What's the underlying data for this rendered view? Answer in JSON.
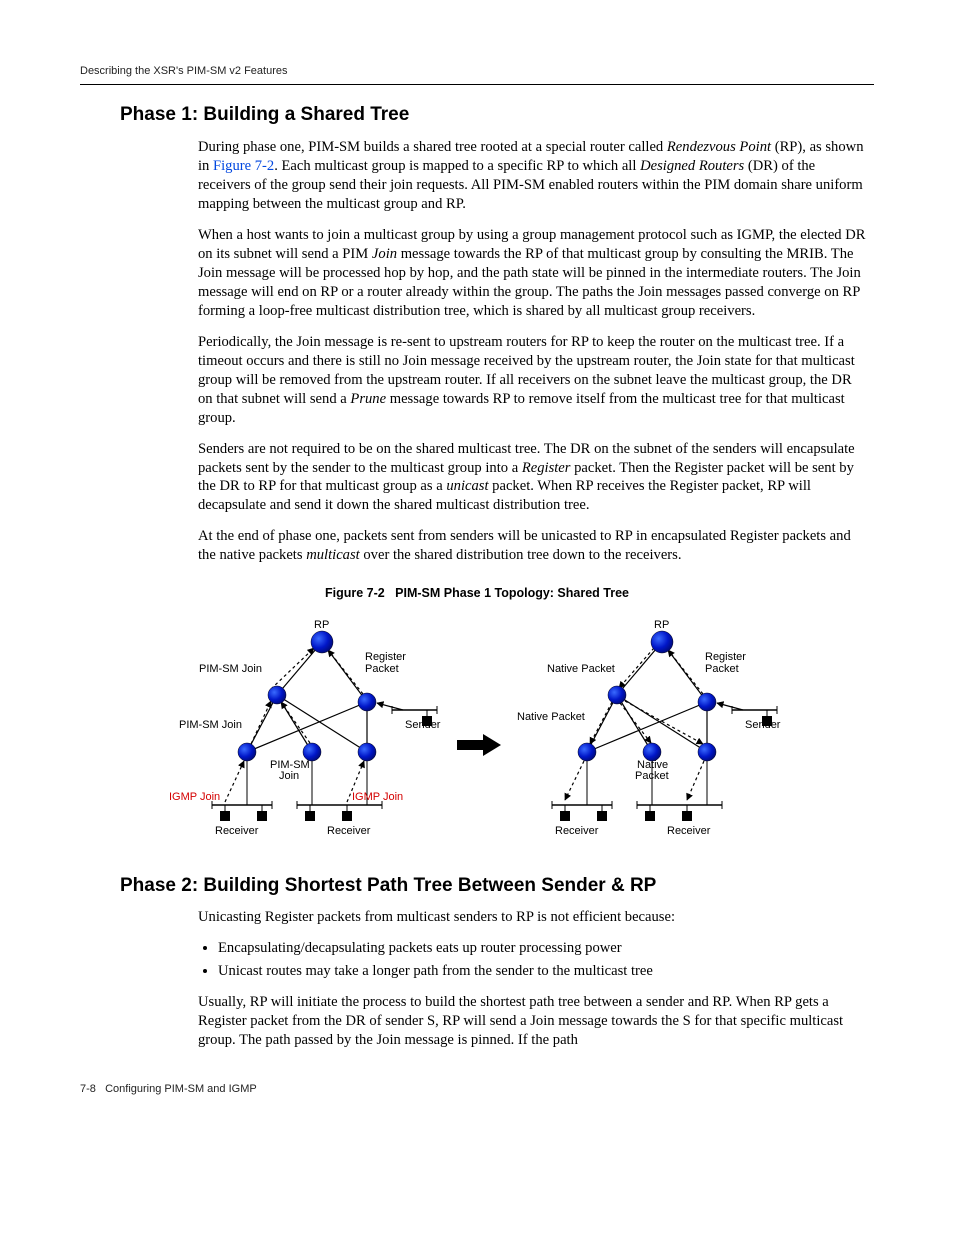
{
  "running_header": "Describing the XSR's PIM-SM v2 Features",
  "phase1": {
    "title": "Phase 1: Building a Shared Tree",
    "p1a": "During phase one, PIM-SM builds a shared tree rooted at a special router called ",
    "p1_em1": "Rendezvous Point",
    "p1b": " (RP), as shown in ",
    "p1_link": "Figure 7-2",
    "p1c": ". Each multicast group is mapped to a specific RP to which all ",
    "p1_em2": "Designed Routers",
    "p1d": " (DR) of the receivers of the group send their join requests. All PIM-SM enabled routers within the PIM domain share uniform mapping between the multicast group and RP.",
    "p2a": "When a host wants to join a multicast group by using a group management protocol such as IGMP, the elected DR on its subnet will send a PIM ",
    "p2_em1": "Join",
    "p2b": " message towards the RP of that multicast group by consulting the MRIB. The Join message will be processed hop by hop, and the path state will be pinned in the intermediate routers. The Join message will end on RP or a router already within the group. The paths the Join messages passed converge on RP forming a loop-free multicast distribution tree, which is shared by all multicast group receivers.",
    "p3a": "Periodically, the Join message is re-sent to upstream routers for RP to keep the router on the multicast tree. If a timeout occurs and there is still no Join message received by the upstream router, the Join state for that multicast group will be removed from the upstream router. If all receivers on the subnet leave the multicast group, the DR on that subnet will send a ",
    "p3_em1": "Prune",
    "p3b": " message towards RP to remove itself from the multicast tree for that multicast group.",
    "p4a": "Senders are not required to be on the shared multicast tree. The DR on the subnet of the senders will encapsulate packets sent by the sender to the multicast group into a ",
    "p4_em1": "Register",
    "p4b": " packet. Then the Register packet will be sent by the DR to RP for that multicast group as a ",
    "p4_em2": "unicast",
    "p4c": " packet. When RP receives the Register packet, RP will decapsulate and send it down the shared multicast distribution tree.",
    "p5a": "At the end of phase one, packets sent from senders will be unicasted to RP in encapsulated Register packets and the native packets ",
    "p5_em1": "multicast",
    "p5b": " over the shared distribution tree down to the receivers."
  },
  "figure": {
    "label": "Figure 7-2",
    "title": "PIM-SM Phase 1 Topology: Shared Tree",
    "labels": {
      "rp": "RP",
      "pim_join": "PIM-SM Join",
      "pim_join2": "PIM-SM",
      "pim_join2b": "Join",
      "register": "Register",
      "packet": "Packet",
      "sender": "Sender",
      "igmp_join": "IGMP Join",
      "receiver": "Receiver",
      "native": "Native Packet",
      "native2a": "Native",
      "native2b": "Packet"
    }
  },
  "phase2": {
    "title": "Phase 2: Building Shortest Path Tree Between Sender & RP",
    "intro": "Unicasting Register packets from multicast senders to RP is not efficient because:",
    "bullets": [
      "Encapsulating/decapsulating packets eats up router processing power",
      "Unicast routes may take a longer path from the sender to the multicast tree"
    ],
    "p1": "Usually, RP will initiate the process to build the shortest path tree between a sender and RP. When RP gets a Register packet from the DR of sender S, RP will send a Join message towards the S for that specific multicast group. The path passed by the Join message is pinned. If the path"
  },
  "footer": {
    "pagenum": "7-8",
    "chapter": "Configuring PIM-SM and IGMP"
  }
}
